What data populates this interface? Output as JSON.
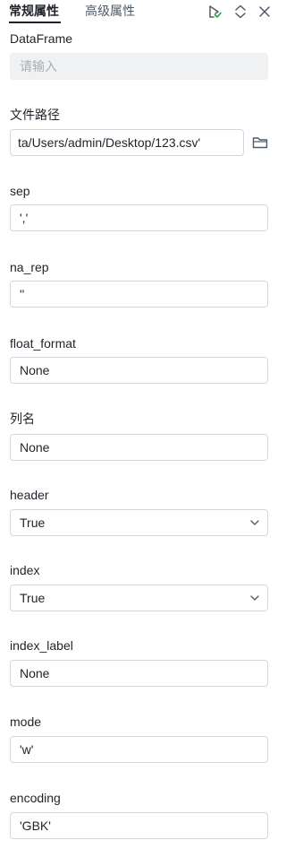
{
  "tabs": {
    "active": "常规属性",
    "inactive": "高级属性"
  },
  "toolbar": {
    "icons": [
      "run-icon",
      "expand-collapse-icon",
      "close-icon"
    ],
    "accent_color": "#14a24d"
  },
  "fields": {
    "dataframe": {
      "label": "DataFrame",
      "placeholder": "请输入",
      "value": ""
    },
    "file_path": {
      "label": "文件路径",
      "value": "ta/Users/admin/Desktop/123.csv'"
    },
    "sep": {
      "label": "sep",
      "value": "','"
    },
    "na_rep": {
      "label": "na_rep",
      "value": "''"
    },
    "float_format": {
      "label": "float_format",
      "value": "None"
    },
    "columns": {
      "label": "列名",
      "value": "None"
    },
    "header": {
      "label": "header",
      "value": "True"
    },
    "index": {
      "label": "index",
      "value": "True"
    },
    "index_label": {
      "label": "index_label",
      "value": "None"
    },
    "mode": {
      "label": "mode",
      "value": "'w'"
    },
    "encoding": {
      "label": "encoding",
      "value": "'GBK'"
    }
  }
}
